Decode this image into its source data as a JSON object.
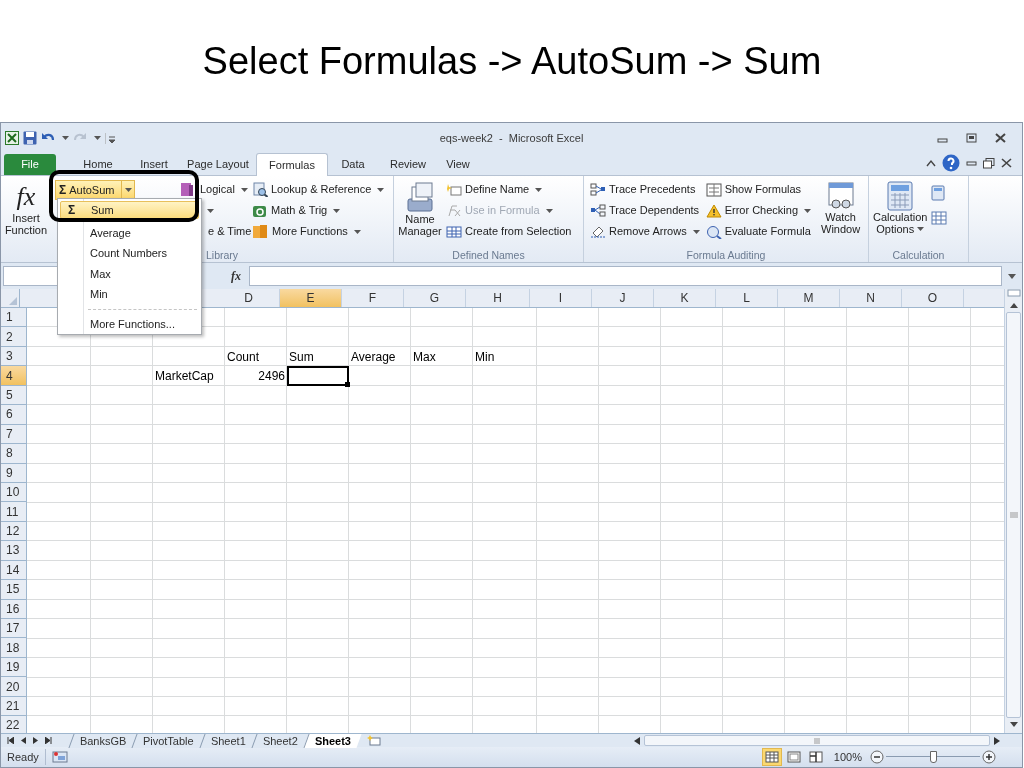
{
  "slide_title": "Select Formulas -> AutoSum -> Sum",
  "window": {
    "title": "eqs-week2  -  Microsoft Excel"
  },
  "tabs": [
    {
      "label": "File",
      "kind": "file",
      "selected": false
    },
    {
      "label": "Home",
      "kind": "tab",
      "selected": false
    },
    {
      "label": "Insert",
      "kind": "tab",
      "selected": false
    },
    {
      "label": "Page Layout",
      "kind": "tab",
      "selected": false
    },
    {
      "label": "Formulas",
      "kind": "tab",
      "selected": true
    },
    {
      "label": "Data",
      "kind": "tab",
      "selected": false
    },
    {
      "label": "Review",
      "kind": "tab",
      "selected": false
    },
    {
      "label": "View",
      "kind": "tab",
      "selected": false
    }
  ],
  "function_library": {
    "insert_function_icon": "fx",
    "insert_function": [
      "Insert",
      "Function"
    ],
    "autosum_icon": "Σ",
    "autosum": "AutoSum",
    "logical": "Logical",
    "date_time": "e & Time",
    "lookup": "Lookup & Reference",
    "math": "Math & Trig",
    "more": "More Functions",
    "group_label": "Library"
  },
  "defined_names": {
    "name_manager": [
      "Name",
      "Manager"
    ],
    "items": [
      {
        "label": "Define Name",
        "disabled": false,
        "dropdown": true
      },
      {
        "label": "Use in Formula",
        "disabled": true,
        "dropdown": true
      },
      {
        "label": "Create from Selection",
        "disabled": false,
        "dropdown": false
      }
    ],
    "group_label": "Defined Names"
  },
  "formula_auditing": {
    "items": [
      {
        "label": "Trace Precedents",
        "dropdown": false
      },
      {
        "label": "Trace Dependents",
        "dropdown": false
      },
      {
        "label": "Remove Arrows",
        "dropdown": true
      },
      {
        "label": "Show Formulas",
        "dropdown": false
      },
      {
        "label": "Error Checking",
        "dropdown": true
      },
      {
        "label": "Evaluate Formula",
        "dropdown": false
      }
    ],
    "watch_window": [
      "Watch",
      "Window"
    ],
    "group_label": "Formula Auditing"
  },
  "calculation": {
    "options": [
      "Calculation",
      "Options"
    ],
    "group_label": "Calculation"
  },
  "formula_bar": {
    "icon": "fx"
  },
  "autosum_menu": [
    {
      "label": "Sum",
      "icon": "Σ",
      "kind": "sum",
      "selected": true
    },
    {
      "label": "Average",
      "kind": "item",
      "selected": false
    },
    {
      "label": "Count Numbers",
      "kind": "item",
      "selected": false
    },
    {
      "label": "Max",
      "kind": "item",
      "selected": false
    },
    {
      "label": "Min",
      "kind": "item",
      "selected": false
    },
    {
      "label": "More Functions...",
      "kind": "more",
      "selected": false
    }
  ],
  "sheet": {
    "columns": [
      {
        "label": "D",
        "selected": false
      },
      {
        "label": "E",
        "selected": true
      },
      {
        "label": "F",
        "selected": false
      },
      {
        "label": "G",
        "selected": false
      },
      {
        "label": "H",
        "selected": false
      },
      {
        "label": "I",
        "selected": false
      },
      {
        "label": "J",
        "selected": false
      },
      {
        "label": "K",
        "selected": false
      },
      {
        "label": "L",
        "selected": false
      },
      {
        "label": "M",
        "selected": false
      },
      {
        "label": "N",
        "selected": false
      },
      {
        "label": "O",
        "selected": false
      }
    ],
    "rows": [
      {
        "label": "1",
        "selected": false
      },
      {
        "label": "2",
        "selected": false
      },
      {
        "label": "3",
        "selected": false,
        "cells": {
          "D": {
            "text": "Count",
            "kind": "text"
          },
          "E": {
            "text": "Sum",
            "kind": "text"
          },
          "F": {
            "text": "Average",
            "kind": "text"
          },
          "G": {
            "text": "Max",
            "kind": "text"
          },
          "H": {
            "text": "Min",
            "kind": "text"
          }
        }
      },
      {
        "label": "4",
        "selected": true,
        "cells": {
          "C": {
            "text": "MarketCap",
            "kind": "text"
          },
          "D": {
            "text": "2496",
            "kind": "number"
          }
        }
      },
      {
        "label": "5",
        "selected": false
      },
      {
        "label": "6",
        "selected": false
      },
      {
        "label": "7",
        "selected": false
      },
      {
        "label": "8",
        "selected": false
      },
      {
        "label": "9",
        "selected": false
      },
      {
        "label": "10",
        "selected": false
      },
      {
        "label": "11",
        "selected": false
      },
      {
        "label": "12",
        "selected": false
      },
      {
        "label": "13",
        "selected": false
      },
      {
        "label": "14",
        "selected": false
      },
      {
        "label": "15",
        "selected": false
      },
      {
        "label": "16",
        "selected": false
      },
      {
        "label": "17",
        "selected": false
      },
      {
        "label": "18",
        "selected": false
      },
      {
        "label": "19",
        "selected": false
      },
      {
        "label": "20",
        "selected": false
      },
      {
        "label": "21",
        "selected": false
      },
      {
        "label": "22",
        "selected": false
      }
    ]
  },
  "sheet_tabs": [
    {
      "label": "BanksGB",
      "selected": false
    },
    {
      "label": "PivotTable",
      "selected": false
    },
    {
      "label": "Sheet1",
      "selected": false
    },
    {
      "label": "Sheet2",
      "selected": false
    },
    {
      "label": "Sheet3",
      "selected": true
    }
  ],
  "status_bar": {
    "text": "Ready",
    "views": [
      {
        "kind": "normal",
        "selected": true
      },
      {
        "kind": "page_layout",
        "selected": false
      },
      {
        "kind": "page_break",
        "selected": false
      }
    ],
    "zoom": {
      "reading": "100%",
      "level": 0.5
    }
  }
}
